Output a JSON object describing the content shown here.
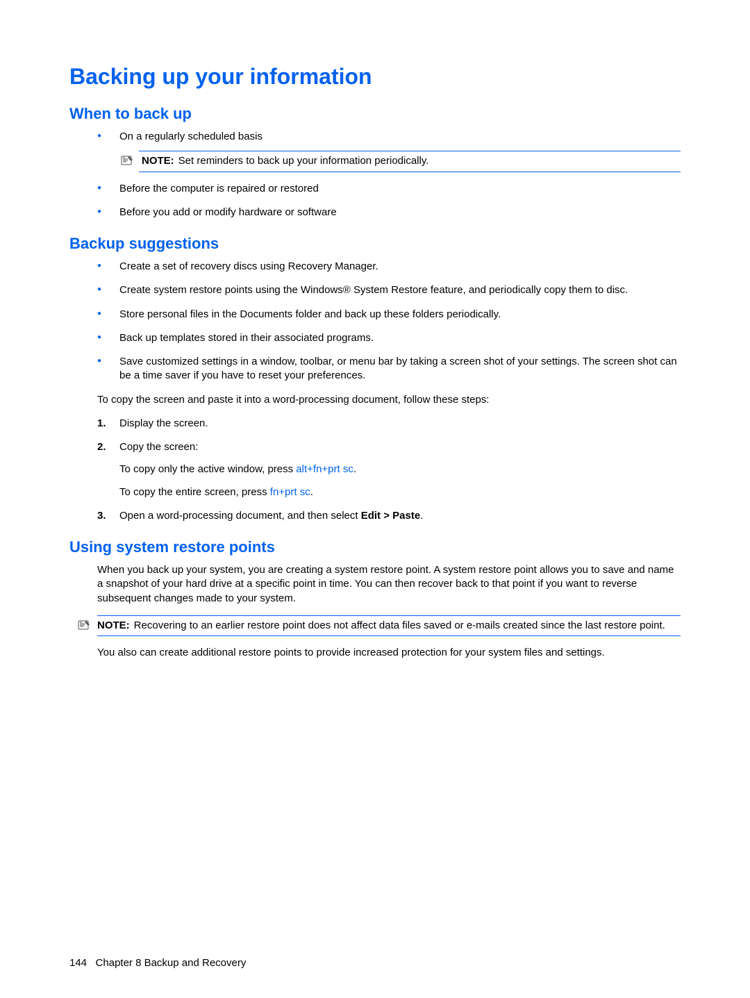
{
  "h1": "Backing up your information",
  "section_when": {
    "title": "When to back up",
    "bullets": [
      "On a regularly scheduled basis",
      "Before the computer is repaired or restored",
      "Before you add or modify hardware or software"
    ],
    "note_label": "NOTE:",
    "note_text": "Set reminders to back up your information periodically."
  },
  "section_sugg": {
    "title": "Backup suggestions",
    "bullets": [
      "Create a set of recovery discs using Recovery Manager.",
      "Create system restore points using the Windows® System Restore feature, and periodically copy them to disc.",
      "Store personal files in the Documents folder and back up these folders periodically.",
      "Back up templates stored in their associated programs.",
      "Save customized settings in a window, toolbar, or menu bar by taking a screen shot of your settings. The screen shot can be a time saver if you have to reset your preferences."
    ],
    "para_copy": "To copy the screen and paste it into a word-processing document, follow these steps:",
    "steps": {
      "s1": "Display the screen.",
      "s2": "Copy the screen:",
      "s2a_pre": "To copy only the active window, press ",
      "s2a_key": "alt+fn+prt sc",
      "s2b_pre": "To copy the entire screen, press ",
      "s2b_key": "fn+prt sc",
      "s3_pre": "Open a word-processing document, and then select ",
      "s3_bold": "Edit > Paste",
      "period": "."
    },
    "nums": {
      "n1": "1.",
      "n2": "2.",
      "n3": "3."
    }
  },
  "section_restore": {
    "title": "Using system restore points",
    "para1": "When you back up your system, you are creating a system restore point. A system restore point allows you to save and name a snapshot of your hard drive at a specific point in time. You can then recover back to that point if you want to reverse subsequent changes made to your system.",
    "note_label": "NOTE:",
    "note_text": "Recovering to an earlier restore point does not affect data files saved or e-mails created since the last restore point.",
    "para2": "You also can create additional restore points to provide increased protection for your system files and settings."
  },
  "footer": {
    "page_num": "144",
    "chapter": "Chapter 8   Backup and Recovery"
  }
}
